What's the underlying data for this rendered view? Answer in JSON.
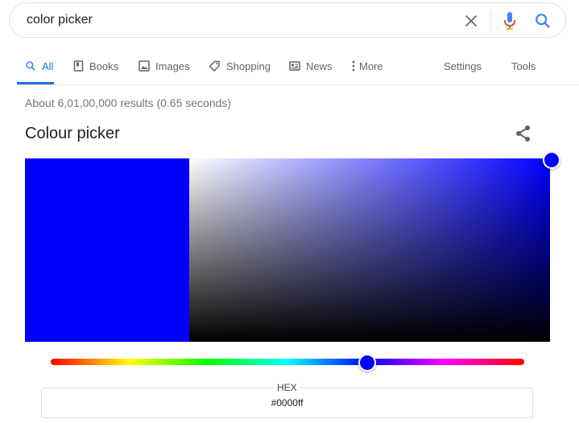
{
  "search": {
    "query": "color picker",
    "clear_icon": "close-icon",
    "mic_icon": "microphone-icon",
    "search_icon": "search-icon"
  },
  "tabs": [
    {
      "label": "All",
      "icon": "search-icon",
      "active": true
    },
    {
      "label": "Books",
      "icon": "book-icon"
    },
    {
      "label": "Images",
      "icon": "image-icon"
    },
    {
      "label": "Shopping",
      "icon": "tag-icon"
    },
    {
      "label": "News",
      "icon": "newspaper-icon"
    },
    {
      "label": "More",
      "icon": "kebab-icon"
    },
    {
      "label": "Settings"
    },
    {
      "label": "Tools"
    }
  ],
  "results": {
    "stats": "About 6,01,00,000 results (0.65 seconds)"
  },
  "widget": {
    "title": "Colour picker",
    "share_icon": "share-icon",
    "hex_label": "HEX",
    "hex_value": "#0000ff",
    "selected_color": "#0000ff",
    "hue_fraction": 0.667,
    "saturation": 1.0,
    "value": 1.0
  },
  "colors": {
    "accent": "#1a73e8",
    "selected": "#0000ff"
  }
}
